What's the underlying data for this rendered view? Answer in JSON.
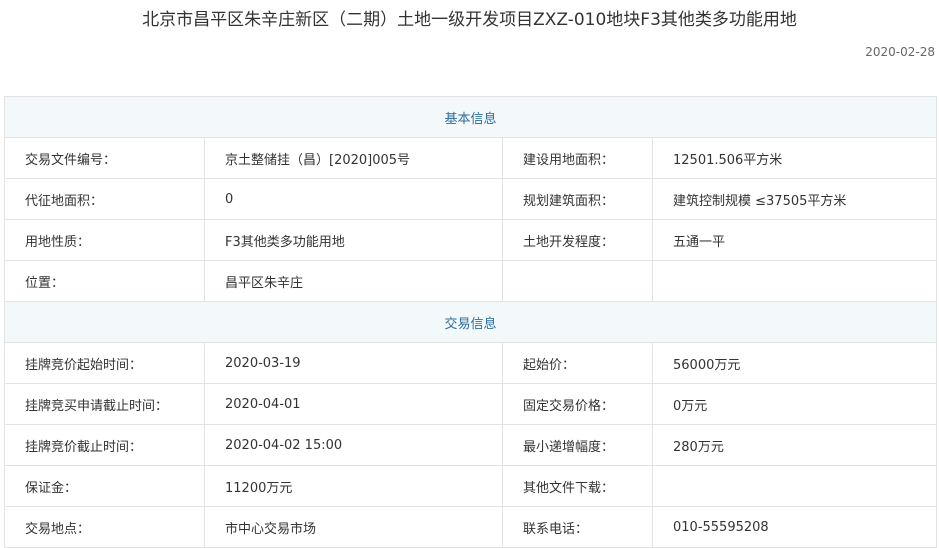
{
  "header": {
    "title": "北京市昌平区朱辛庄新区（二期）土地一级开发项目ZXZ-010地块F3其他类多功能用地",
    "date": "2020-02-28"
  },
  "sections": {
    "basic": {
      "title": "基本信息",
      "rows": [
        [
          {
            "label": "交易文件编号：",
            "value": "京土整储挂（昌）[2020]005号"
          },
          {
            "label": "建设用地面积：",
            "value": "12501.506平方米"
          }
        ],
        [
          {
            "label": "代征地面积：",
            "value": "0"
          },
          {
            "label": "规划建筑面积：",
            "value": "建筑控制规模 ≤37505平方米"
          }
        ],
        [
          {
            "label": "用地性质：",
            "value": "F3其他类多功能用地"
          },
          {
            "label": "土地开发程度：",
            "value": "五通一平"
          }
        ],
        [
          {
            "label": "位置：",
            "value": "昌平区朱辛庄"
          },
          {
            "label": "",
            "value": ""
          }
        ]
      ]
    },
    "trade": {
      "title": "交易信息",
      "rows": [
        [
          {
            "label": "挂牌竞价起始时间：",
            "value": "2020-03-19"
          },
          {
            "label": "起始价：",
            "value": "56000万元"
          }
        ],
        [
          {
            "label": "挂牌竞买申请截止时间：",
            "value": "2020-04-01"
          },
          {
            "label": "固定交易价格：",
            "value": "0万元"
          }
        ],
        [
          {
            "label": "挂牌竞价截止时间：",
            "value": "2020-04-02 15:00"
          },
          {
            "label": "最小递增幅度：",
            "value": "280万元"
          }
        ],
        [
          {
            "label": "保证金：",
            "value": "11200万元"
          },
          {
            "label": "其他文件下载：",
            "value": ""
          }
        ],
        [
          {
            "label": "交易地点：",
            "value": "市中心交易市场"
          },
          {
            "label": "联系电话：",
            "value": "010-55595208"
          }
        ]
      ]
    }
  }
}
